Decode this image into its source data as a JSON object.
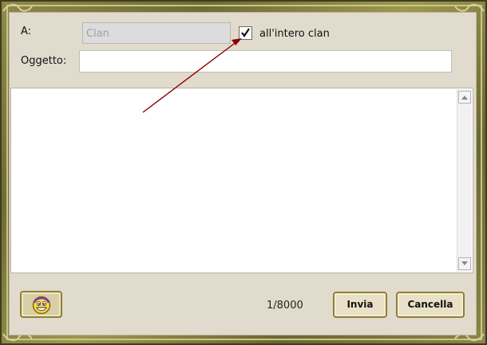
{
  "form": {
    "to_label": "A:",
    "to_value": "Clan",
    "all_clan_label": "all'intero clan",
    "all_clan_checked": true,
    "subject_label": "Oggetto:",
    "subject_value": "",
    "body_value": ""
  },
  "footer": {
    "counter": "1/8000",
    "send_label": "Invia",
    "cancel_label": "Cancella",
    "emoji_icon": "smiley-icon"
  },
  "colors": {
    "panel": "#e1dbcd",
    "frame": "#8d8a4a",
    "arrow": "#8b0000"
  }
}
